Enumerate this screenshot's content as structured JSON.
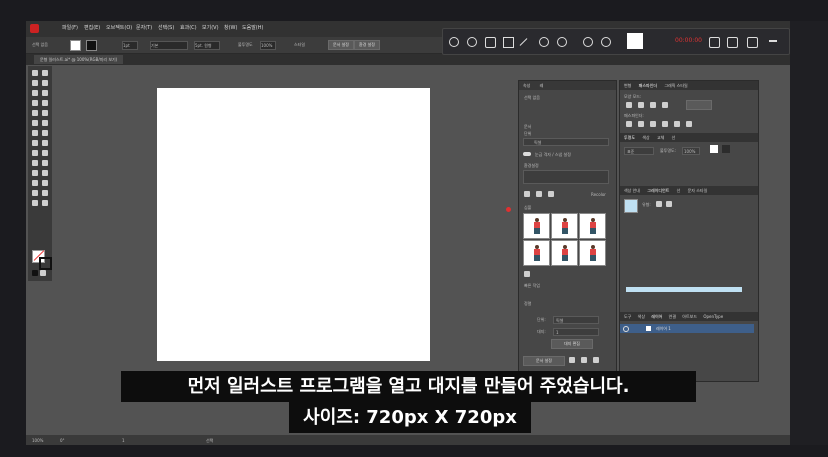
{
  "menu": {
    "items": [
      "파일(F)",
      "편집(E)",
      "오브젝트(O)",
      "문자(T)",
      "선택(S)",
      "효과(C)",
      "보기(V)",
      "창(W)",
      "도움말(H)"
    ]
  },
  "control_bar": {
    "selection_label": "선택 없음",
    "stroke_weight": "1pt",
    "stroke_style": "기본",
    "brush": "5pt. 원형",
    "opacity_label": "불투명도",
    "opacity_value": "100%",
    "style_label": "스타일",
    "doc_setup": "문서 설정",
    "prefs": "환경 설정"
  },
  "document_tab": {
    "label": "문형 일러스트.ai* @ 100%(RGB/미리 보기)"
  },
  "recorder": {
    "time": "00:00:00"
  },
  "props_panel": {
    "tabs": [
      "속성",
      "레"
    ],
    "section_selection": "선택 없음",
    "doc_label": "문서",
    "unit_label": "단위",
    "unit_value": "픽셀",
    "artboard_label": "대지",
    "show_grid": "눈금 격자 / 스냅 설정",
    "prefs_label": "환경설정",
    "recolor": "Recolor",
    "symbols_label": "심볼",
    "quick_actions": "빠른 작업",
    "edit_artboard": "대지 편집",
    "doc_setup_btn": "문서 설정",
    "align_label": "정렬",
    "units_row": "단위:",
    "units_row_value": "픽셀",
    "artboard_row": "대지:",
    "artboard_row_value": "1"
  },
  "pathfinder_panel": {
    "tabs": [
      "변형",
      "패스파인더",
      "그래픽 스타일"
    ],
    "shape_modes": "모양 모드:",
    "pathfinders": "패스파인더:"
  },
  "transparency_panel": {
    "tabs": [
      "투명도",
      "색상",
      "교체",
      "선"
    ],
    "mode": "표준",
    "opacity_label": "불투명도:",
    "opacity": "100%"
  },
  "gradient_panel": {
    "tabs": [
      "색상 안내",
      "그레이디언트",
      "선",
      "문자 스타일"
    ],
    "type_label": "유형:"
  },
  "layers_panel": {
    "tabs": [
      "도구",
      "색상",
      "레이어",
      "연결",
      "아트보드",
      "OpenType"
    ],
    "layer_name": "레이어 1"
  },
  "status_bar": {
    "zoom": "100%",
    "rotation": "0°",
    "page": "1",
    "mode": "선택"
  },
  "subtitles": {
    "line1": "먼저 일러스트 프로그램을 열고 대지를 만들어 주었습니다.",
    "line2": "사이즈: 720px X 720px"
  }
}
